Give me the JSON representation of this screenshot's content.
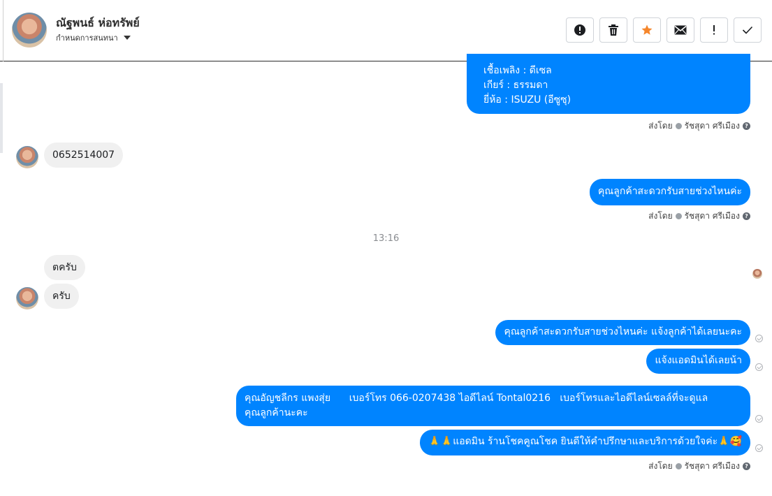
{
  "header": {
    "contact_name": "ณัฐพนธ์ ห่อทรัพย์",
    "assign_label": "กำหนดการสนทนา",
    "toolbar": [
      {
        "icon": "alert-circle-icon",
        "label": "report"
      },
      {
        "icon": "trash-icon",
        "label": "delete"
      },
      {
        "icon": "star-icon",
        "label": "star",
        "color": "#f5862b"
      },
      {
        "icon": "envelope-icon",
        "label": "mark unread"
      },
      {
        "icon": "exclamation-icon",
        "label": "spam"
      },
      {
        "icon": "checkmark-icon",
        "label": "done"
      }
    ]
  },
  "messages": {
    "top_card_lines": [
      "เชื้อเพลิง : ดีเซล",
      "เกียร์ : ธรรมดา",
      "ยี่ห้อ : ISUZU (อีซูซุ)"
    ],
    "sent_by_1": "ส่งโดย",
    "sender_1": "รัชสุดา ศรีเมือง",
    "in_phone": "0652514007",
    "out_ask": "คุณลูกค้าสะดวกรับสายช่วงไหนค่ะ",
    "sent_by_2": "ส่งโดย",
    "sender_2": "รัชสุดา ศรีเมือง",
    "time_sep": "13:16",
    "in_1": "ตครับ",
    "in_2": "ครับ",
    "out_2": "คุณลูกค้าสะดวกรับสายช่วงไหนค่ะ  แจ้งลูกค้าได้เลยนะคะ",
    "out_3": "แจ้งแอดมินได้เลยน้า",
    "out_4_line1": "คุณอัญชลีกร แพงสุ่ย      เบอร์โทร 066-0207438 ไอดีไลน์ Tontal0216   เบอร์โทรและไอดีไลน์เซลล์ที่จะดูแล",
    "out_4_line2": "คุณลูกค้านะคะ",
    "out_5": "🙏🙏แอดมิน ร้านโชคคูณโชค ยินดีให้คำปรึกษาและบริการด้วยใจค่ะ🙏🥰",
    "sent_by_3": "ส่งโดย",
    "sender_3": "รัชสุดา ศรีเมือง"
  },
  "colors": {
    "outgoing_bubble": "#0084ff",
    "incoming_bubble": "#f0f0f0",
    "star_accent": "#f5862b"
  }
}
